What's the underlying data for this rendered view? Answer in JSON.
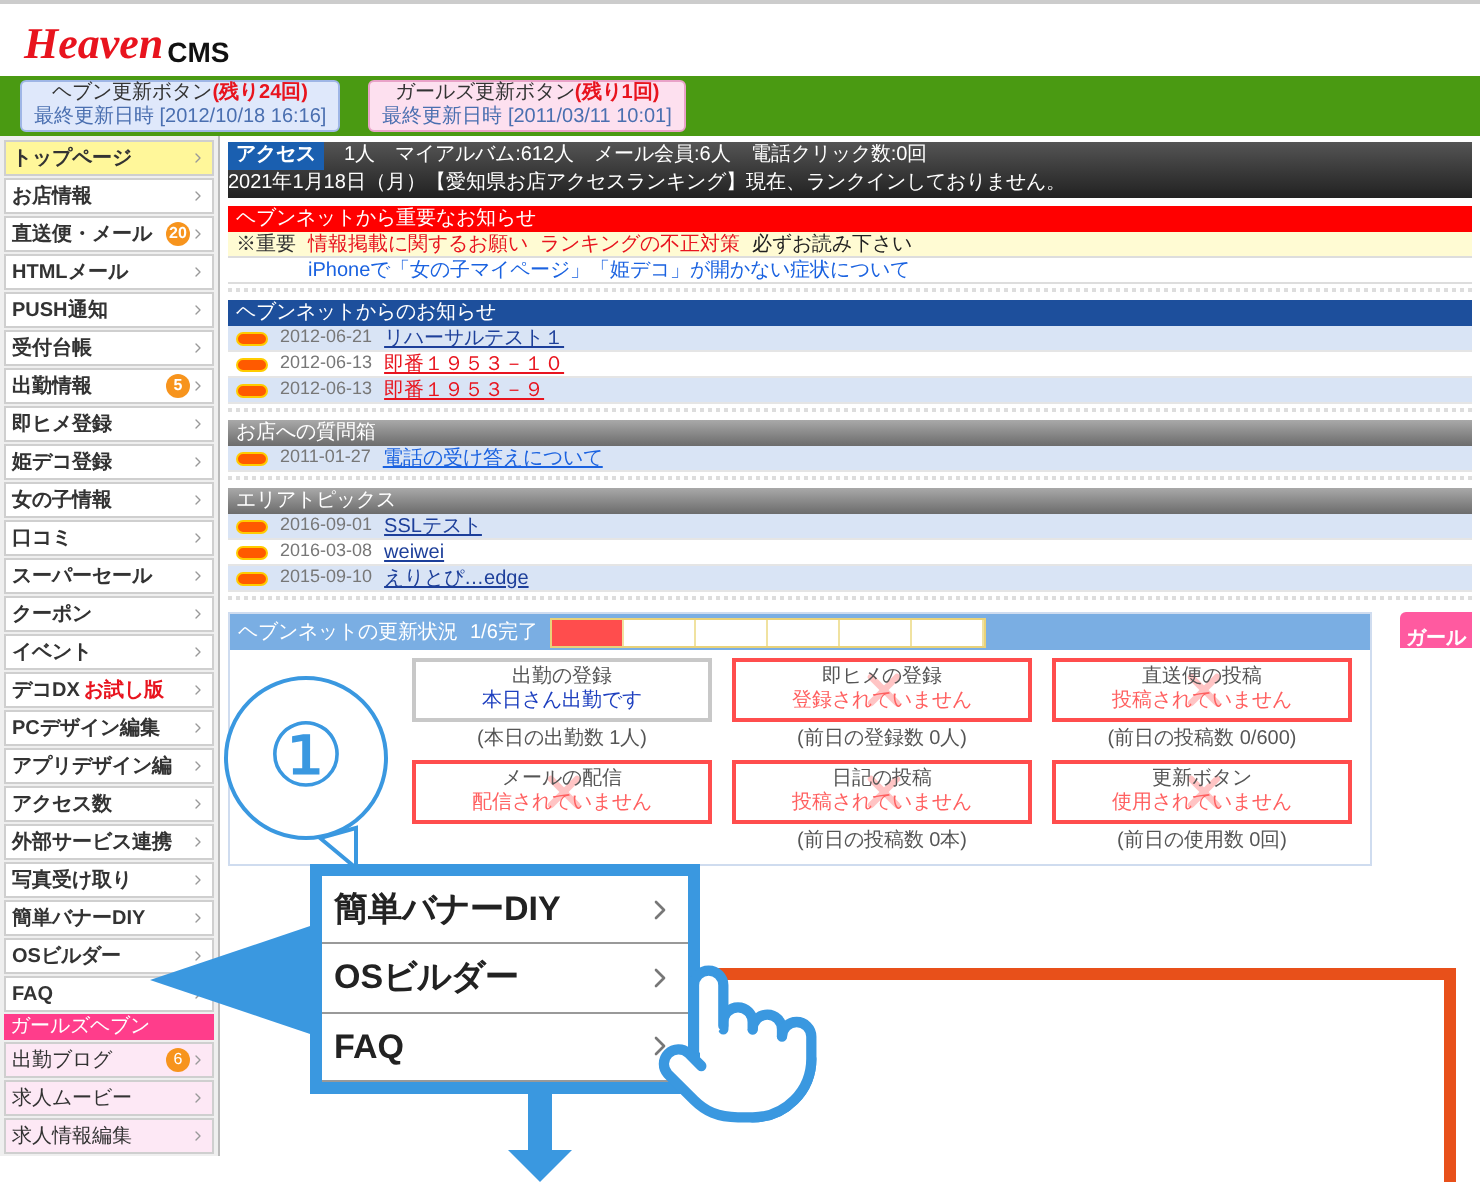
{
  "logo": {
    "brand": "Heaven",
    "suffix": "CMS"
  },
  "header_buttons": [
    {
      "kind": "heaven",
      "label": "ヘブン更新ボタン",
      "remaining": "(残り24回)",
      "updated": "最終更新日時 [2012/10/18 16:16]"
    },
    {
      "kind": "girls",
      "label": "ガールズ更新ボタン",
      "remaining": "(残り1回)",
      "updated": "最終更新日時 [2011/03/11 10:01]"
    }
  ],
  "sidebar": {
    "items": [
      {
        "kind": "item",
        "label": "トップページ",
        "selected": true
      },
      {
        "kind": "item",
        "label": "お店情報",
        "selected": false
      },
      {
        "kind": "item",
        "label": "直送便・メール",
        "badge": "20",
        "selected": false
      },
      {
        "kind": "item",
        "label": "HTMLメール",
        "selected": false
      },
      {
        "kind": "item",
        "label": "PUSH通知",
        "selected": false
      },
      {
        "kind": "item",
        "label": "受付台帳",
        "selected": false
      },
      {
        "kind": "item",
        "label": "出勤情報",
        "badge": "5",
        "selected": false
      },
      {
        "kind": "item",
        "label": "即ヒメ登録",
        "selected": false
      },
      {
        "kind": "item",
        "label": "姫デコ登録",
        "selected": false
      },
      {
        "kind": "item",
        "label": "女の子情報",
        "selected": false
      },
      {
        "kind": "item",
        "label": "口コミ",
        "selected": false
      },
      {
        "kind": "item",
        "label": "スーパーセール",
        "selected": false
      },
      {
        "kind": "item",
        "label": "クーポン",
        "selected": false
      },
      {
        "kind": "item",
        "label": "イベント",
        "selected": false
      },
      {
        "kind": "item",
        "label": "デコDX",
        "note": "お試し版",
        "selected": false
      },
      {
        "kind": "item",
        "label": "PCデザイン編集",
        "selected": false
      },
      {
        "kind": "item",
        "label": "アプリデザイン編",
        "selected": false
      },
      {
        "kind": "item",
        "label": "アクセス数",
        "selected": false
      },
      {
        "kind": "item",
        "label": "外部サービス連携",
        "selected": false
      },
      {
        "kind": "item",
        "label": "写真受け取り",
        "selected": false
      },
      {
        "kind": "item",
        "label": "簡単バナーDIY",
        "selected": false
      },
      {
        "kind": "item",
        "label": "OSビルダー",
        "selected": false
      },
      {
        "kind": "item",
        "label": "FAQ",
        "selected": false
      },
      {
        "kind": "header",
        "label": "ガールズヘブン"
      },
      {
        "kind": "sub",
        "label": "出勤ブログ",
        "badge": "6",
        "selected": false
      },
      {
        "kind": "sub",
        "label": "求人ムービー",
        "selected": false
      },
      {
        "kind": "sub",
        "label": "求人情報編集",
        "selected": false
      }
    ]
  },
  "access_bar": {
    "tag": "アクセス",
    "stats": [
      "1人",
      "マイアルバム:612人",
      "メール会員:6人",
      "電話クリック数:0回"
    ],
    "news": "2021年1月18日（月）【愛知県お店アクセスランキング】現在、ランクインしておりません。"
  },
  "sections": [
    {
      "kind": "important",
      "title": "ヘブンネットから重要なお知らせ",
      "rows": [
        {
          "highlighted": true,
          "label": "※重要",
          "links": [
            {
              "text": "情報掲載に関するお願い",
              "color": "#e8141e"
            },
            {
              "text": "ランキングの不正対策",
              "color": "#e8141e"
            },
            {
              "text": "必ずお読み下さい",
              "color": "#222222"
            }
          ]
        },
        {
          "highlighted": false,
          "links": [
            {
              "text": "iPhoneで「女の子マイページ」「姫デコ」が開かない症状について",
              "color": "#1a62e0"
            }
          ]
        }
      ]
    },
    {
      "kind": "news",
      "title": "ヘブンネットからのお知らせ",
      "rows": [
        {
          "date": "2012-06-21",
          "text": "リハーサルテスト１",
          "color": "#1d3f9a"
        },
        {
          "date": "2012-06-13",
          "text": "即番１９５３－１０",
          "color": "#e8141e"
        },
        {
          "date": "2012-06-13",
          "text": "即番１９５３－９",
          "color": "#e8141e"
        }
      ]
    },
    {
      "kind": "box",
      "title": "お店への質問箱",
      "rows": [
        {
          "date": "2011-01-27",
          "text": "電話の受け答えについて",
          "color": "#1a62e0"
        }
      ]
    },
    {
      "kind": "box",
      "title": "エリアトピックス",
      "rows": [
        {
          "date": "2016-09-01",
          "text": "SSLテスト",
          "color": "#1d3f9a"
        },
        {
          "date": "2016-03-08",
          "text": "weiwei",
          "color": "#1d3f9a"
        },
        {
          "date": "2015-09-10",
          "text": "えりとぴ…edge",
          "color": "#1d3f9a"
        }
      ]
    }
  ],
  "update_status": {
    "title": "ヘブンネットの更新状況",
    "count": "1/6完了",
    "steps": [
      {
        "done": true
      },
      {
        "done": false
      },
      {
        "done": false
      },
      {
        "done": false
      },
      {
        "done": false
      },
      {
        "done": false
      }
    ],
    "cards": [
      {
        "title": "出勤の登録",
        "done": true,
        "status": "本日さん出勤です",
        "caption": "(本日の出勤数 1人)"
      },
      {
        "title": "即ヒメの登録",
        "done": false,
        "status": "登録されていません",
        "caption": "(前日の登録数 0人)"
      },
      {
        "title": "直送便の投稿",
        "done": false,
        "status": "投稿されていません",
        "caption": "(前日の投稿数 0/600)"
      },
      {
        "title": "メールの配信",
        "done": false,
        "status": "配信されていません"
      },
      {
        "title": "日記の投稿",
        "done": false,
        "status": "投稿されていません",
        "caption": "(前日の投稿数 0本)"
      },
      {
        "title": "更新ボタン",
        "done": false,
        "status": "使用されていません",
        "caption": "(前日の使用数 0回)"
      }
    ]
  },
  "girls_status": {
    "title": "ガール"
  },
  "callout": {
    "step": "①",
    "zoom_items": [
      "簡単バナーDIY",
      "OSビルダー",
      "FAQ"
    ]
  }
}
